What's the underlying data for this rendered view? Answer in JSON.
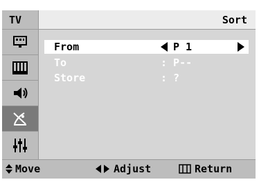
{
  "header": {
    "mode": "TV",
    "title": "Sort"
  },
  "sidebar": {
    "items": [
      {
        "icon": "picture-icon",
        "active": false
      },
      {
        "icon": "channel-icon",
        "active": false
      },
      {
        "icon": "sound-icon",
        "active": false
      },
      {
        "icon": "antenna-icon",
        "active": true
      },
      {
        "icon": "setup-icon",
        "active": false
      }
    ]
  },
  "menu": {
    "from": {
      "label": "From",
      "value": "P 1"
    },
    "to": {
      "label": "To",
      "value": ": P--"
    },
    "store": {
      "label": "Store",
      "value": ": ?"
    }
  },
  "footer": {
    "move": "Move",
    "adjust": "Adjust",
    "return": "Return"
  }
}
